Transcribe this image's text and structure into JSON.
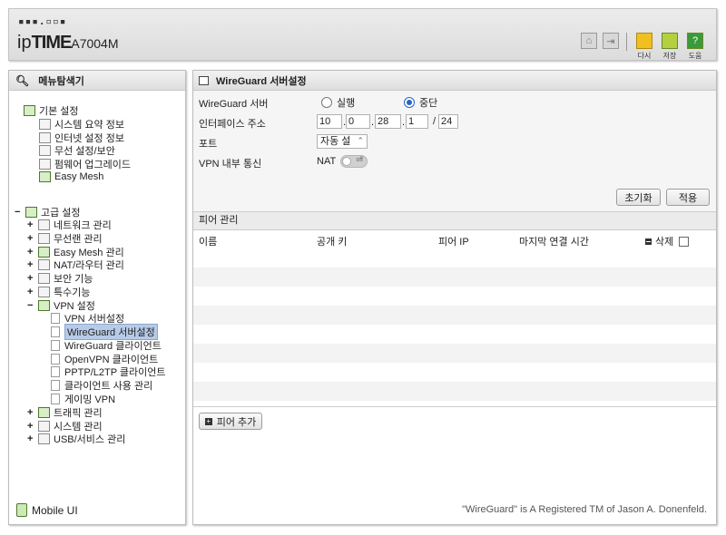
{
  "header": {
    "logo_dots": "▪▪▪.▫▫▪",
    "logo_ip": "ip",
    "logo_time": "TIME",
    "logo_model": "A7004M",
    "buttons": [
      {
        "label": "다시",
        "color": "#f0c020"
      },
      {
        "label": "저장",
        "color": "#b4d040"
      },
      {
        "label": "도움",
        "color": "#3a9a3a"
      }
    ]
  },
  "left": {
    "title": "메뉴탐색기",
    "basic": {
      "label": "기본 설정",
      "items": [
        "시스템 요약 정보",
        "인터넷 설정 정보",
        "무선 설정/보안",
        "펌웨어 업그레이드",
        "Easy Mesh"
      ]
    },
    "advanced": {
      "label": "고급 설정",
      "items": [
        "네트워크 관리",
        "무선랜 관리",
        "Easy Mesh 관리",
        "NAT/라우터 관리",
        "보안 기능",
        "특수기능"
      ],
      "vpn": {
        "label": "VPN 설정",
        "items": [
          "VPN 서버설정",
          "WireGuard 서버설정",
          "WireGuard 클라이언트",
          "OpenVPN 클라이언트",
          "PPTP/L2TP 클라이언트",
          "클라이언트 사용 관리",
          "게이밍 VPN"
        ]
      },
      "after": [
        "트래픽 관리",
        "시스템 관리",
        "USB/서비스 관리"
      ]
    },
    "mobile_ui": "Mobile UI"
  },
  "main": {
    "title": "WireGuard 서버설정",
    "server_label": "WireGuard 서버",
    "run_label": "실행",
    "stop_label": "중단",
    "selected": "중단",
    "iface_label": "인터페이스 주소",
    "ip": [
      "10",
      "0",
      "28",
      "1"
    ],
    "mask": "24",
    "port_label": "포트",
    "port_value": "자동 설",
    "vpn_label": "VPN 내부 통신",
    "nat_label": "NAT",
    "toggle_text": "off",
    "reset_button": "초기화",
    "apply_button": "적용",
    "peer_title": "피어 관리",
    "columns": [
      "이름",
      "공개 키",
      "피어 IP",
      "마지막 연결 시간",
      "삭제"
    ],
    "add_peer": "피어 추가",
    "trademark": "\"WireGuard\" is A Registered TM of Jason A. Donenfeld."
  }
}
